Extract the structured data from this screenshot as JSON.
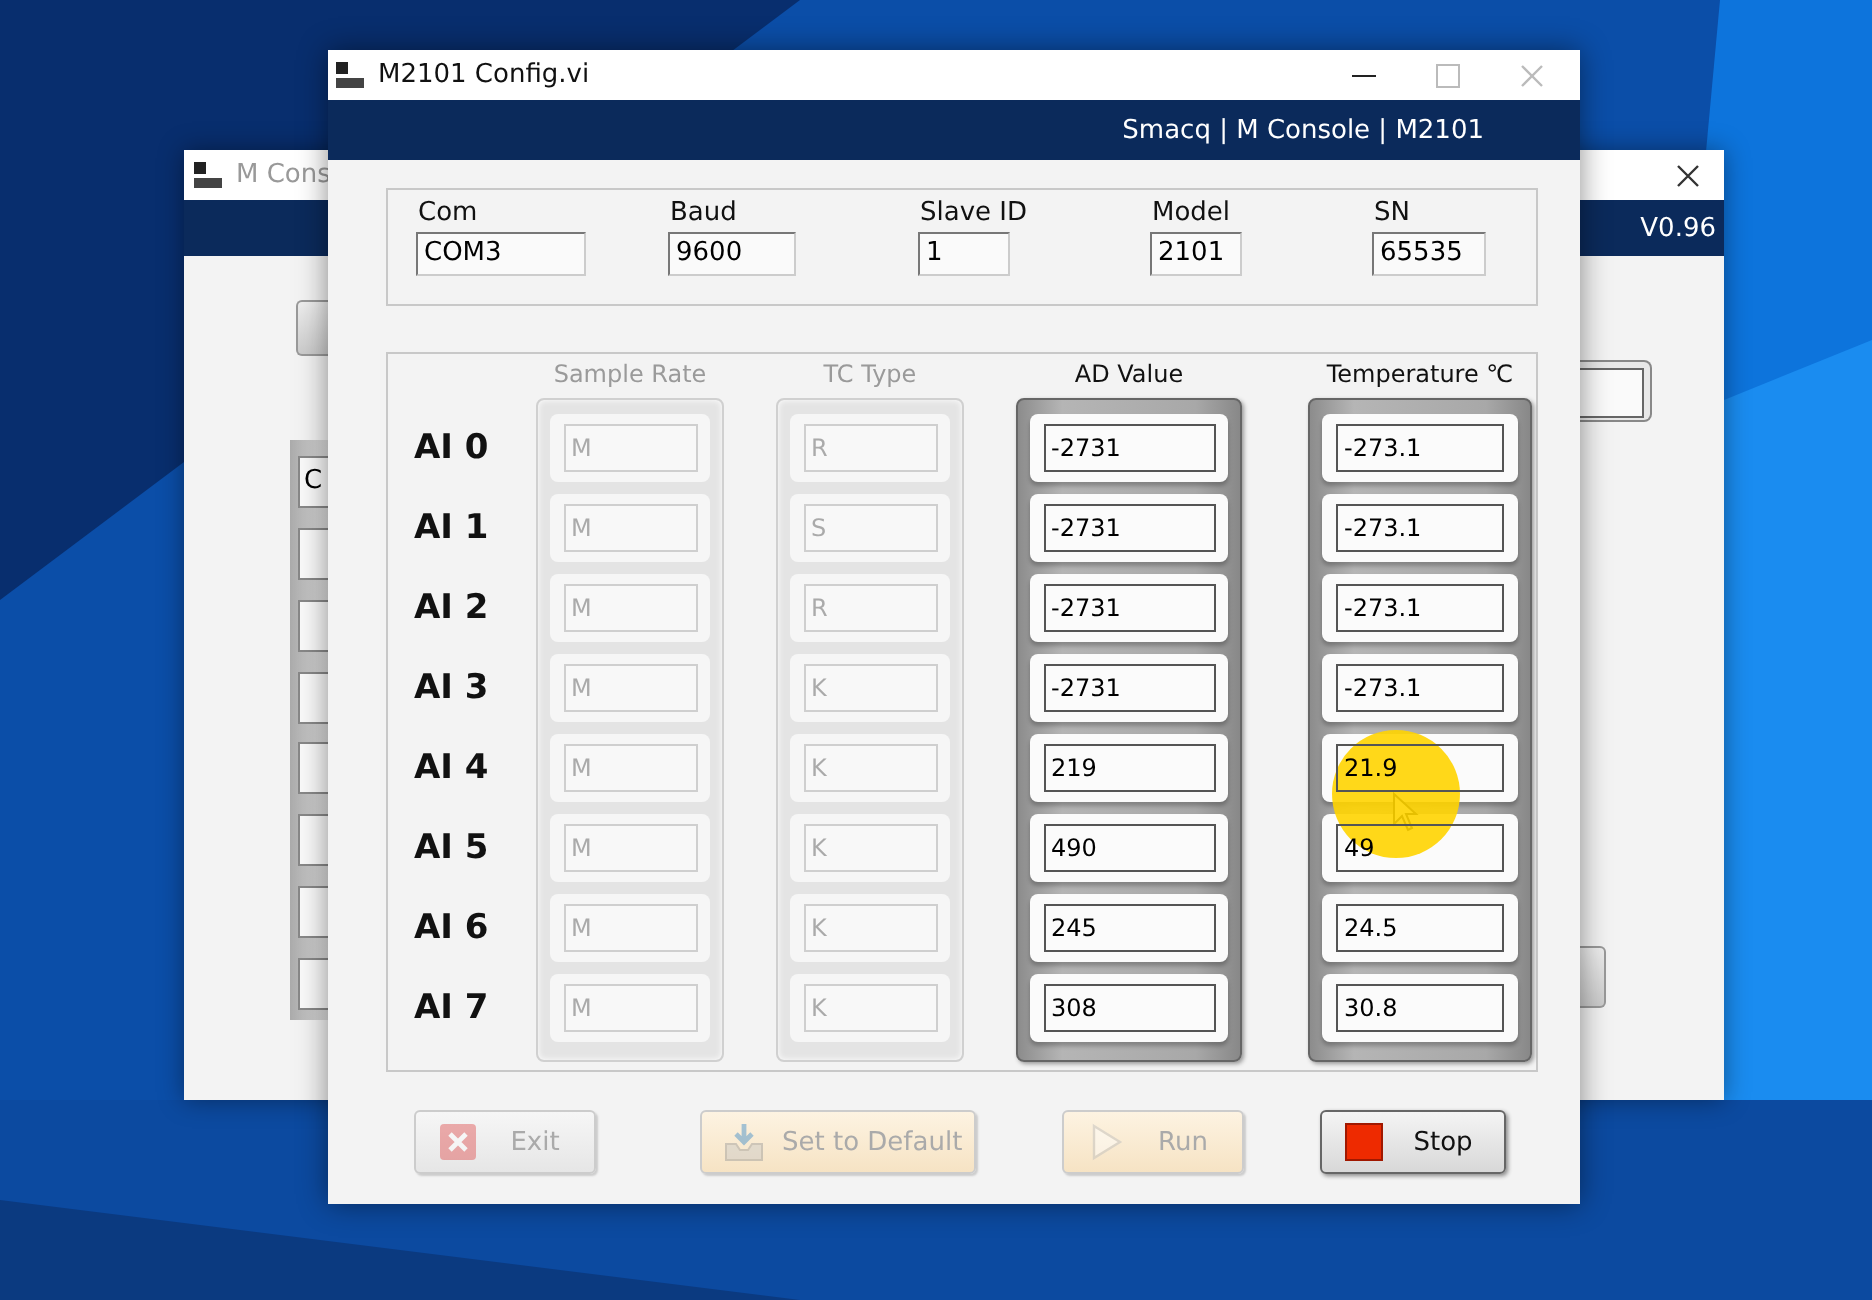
{
  "background_window": {
    "title": "M Cons",
    "header": "V0.96",
    "field_value": "C"
  },
  "window": {
    "title": "M2101 Config.vi",
    "header": "Smacq | M Console | M2101"
  },
  "config_fields": [
    {
      "label": "Com",
      "value": "COM3"
    },
    {
      "label": "Baud",
      "value": "9600"
    },
    {
      "label": "Slave ID",
      "value": "1"
    },
    {
      "label": "Model",
      "value": "2101"
    },
    {
      "label": "SN",
      "value": "65535"
    }
  ],
  "channel_columns": [
    {
      "label": "Sample Rate",
      "disabled": true
    },
    {
      "label": "TC Type",
      "disabled": true
    },
    {
      "label": "AD Value",
      "disabled": false
    },
    {
      "label": "Temperature ℃",
      "disabled": false
    }
  ],
  "channels": [
    {
      "name": "AI 0",
      "values": [
        "M",
        "R",
        "-2731",
        "-273.1"
      ]
    },
    {
      "name": "AI 1",
      "values": [
        "M",
        "S",
        "-2731",
        "-273.1"
      ]
    },
    {
      "name": "AI 2",
      "values": [
        "M",
        "R",
        "-2731",
        "-273.1"
      ]
    },
    {
      "name": "AI 3",
      "values": [
        "M",
        "K",
        "-2731",
        "-273.1"
      ]
    },
    {
      "name": "AI 4",
      "values": [
        "M",
        "K",
        "219",
        "21.9"
      ]
    },
    {
      "name": "AI 5",
      "values": [
        "M",
        "K",
        "490",
        "49"
      ]
    },
    {
      "name": "AI 6",
      "values": [
        "M",
        "K",
        "245",
        "24.5"
      ]
    },
    {
      "name": "AI 7",
      "values": [
        "M",
        "K",
        "308",
        "30.8"
      ]
    }
  ],
  "buttons": [
    {
      "label": "Exit",
      "kind": "exit",
      "disabled": true
    },
    {
      "label": "Set to Default",
      "kind": "default",
      "disabled": true
    },
    {
      "label": "Run",
      "kind": "run",
      "disabled": true
    },
    {
      "label": "Stop",
      "kind": "stop",
      "disabled": false
    }
  ]
}
